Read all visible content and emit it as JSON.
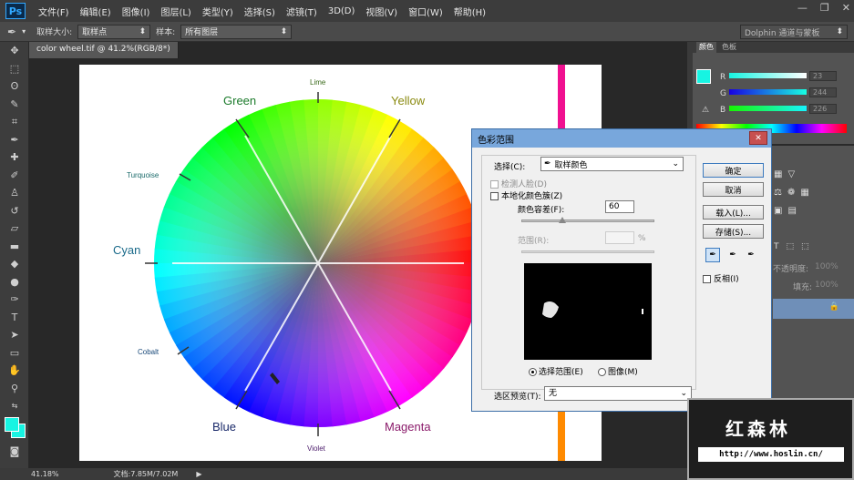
{
  "menubar": {
    "logo": "Ps",
    "items": [
      "文件(F)",
      "编辑(E)",
      "图像(I)",
      "图层(L)",
      "类型(Y)",
      "选择(S)",
      "滤镜(T)",
      "3D(D)",
      "视图(V)",
      "窗口(W)",
      "帮助(H)"
    ]
  },
  "options": {
    "sample_size_label": "取样大小:",
    "sample_size_value": "取样点",
    "sample_label": "样本:",
    "sample_value": "所有图层",
    "workspace": "Dolphin 通道与蒙板"
  },
  "document": {
    "tab": "color wheel.tif @ 41.2%(RGB/8*)",
    "zoom": "41.18%",
    "doc_size": "文档:7.85M/7.02M"
  },
  "wheel_labels": {
    "green": "Green",
    "lime": "Lime",
    "yellow": "Yellow",
    "turquoise": "Turquoise",
    "cyan": "Cyan",
    "cobalt": "Cobalt",
    "blue": "Blue",
    "violet": "Violet",
    "magenta": "Magenta"
  },
  "color_panel": {
    "tab1": "颜色",
    "tab2": "色板",
    "r_label": "R",
    "g_label": "G",
    "b_label": "B",
    "r": "23",
    "g": "244",
    "b": "226",
    "swatch_color": "#17f4e2"
  },
  "layers_panel": {
    "opacity_label": "不透明度:",
    "opacity_value": "100%",
    "fill_label": "填充:",
    "fill_value": "100%"
  },
  "dialog": {
    "title": "色彩范围",
    "close": "✕",
    "select_label": "选择(C):",
    "select_value": "取样颜色",
    "detect_faces": "检测人脸(D)",
    "localized": "本地化颜色簇(Z)",
    "fuzziness_label": "颜色容差(F):",
    "fuzziness_value": "60",
    "range_label": "范围(R):",
    "range_unit": "%",
    "radio_selection": "选择范围(E)",
    "radio_image": "图像(M)",
    "preview_label": "选区预览(T):",
    "preview_value": "无",
    "ok": "确定",
    "cancel": "取消",
    "load": "载入(L)...",
    "save": "存储(S)...",
    "invert": "反相(I)"
  },
  "watermark": {
    "title": "红森林",
    "url": "http://www.hoslin.cn/"
  }
}
